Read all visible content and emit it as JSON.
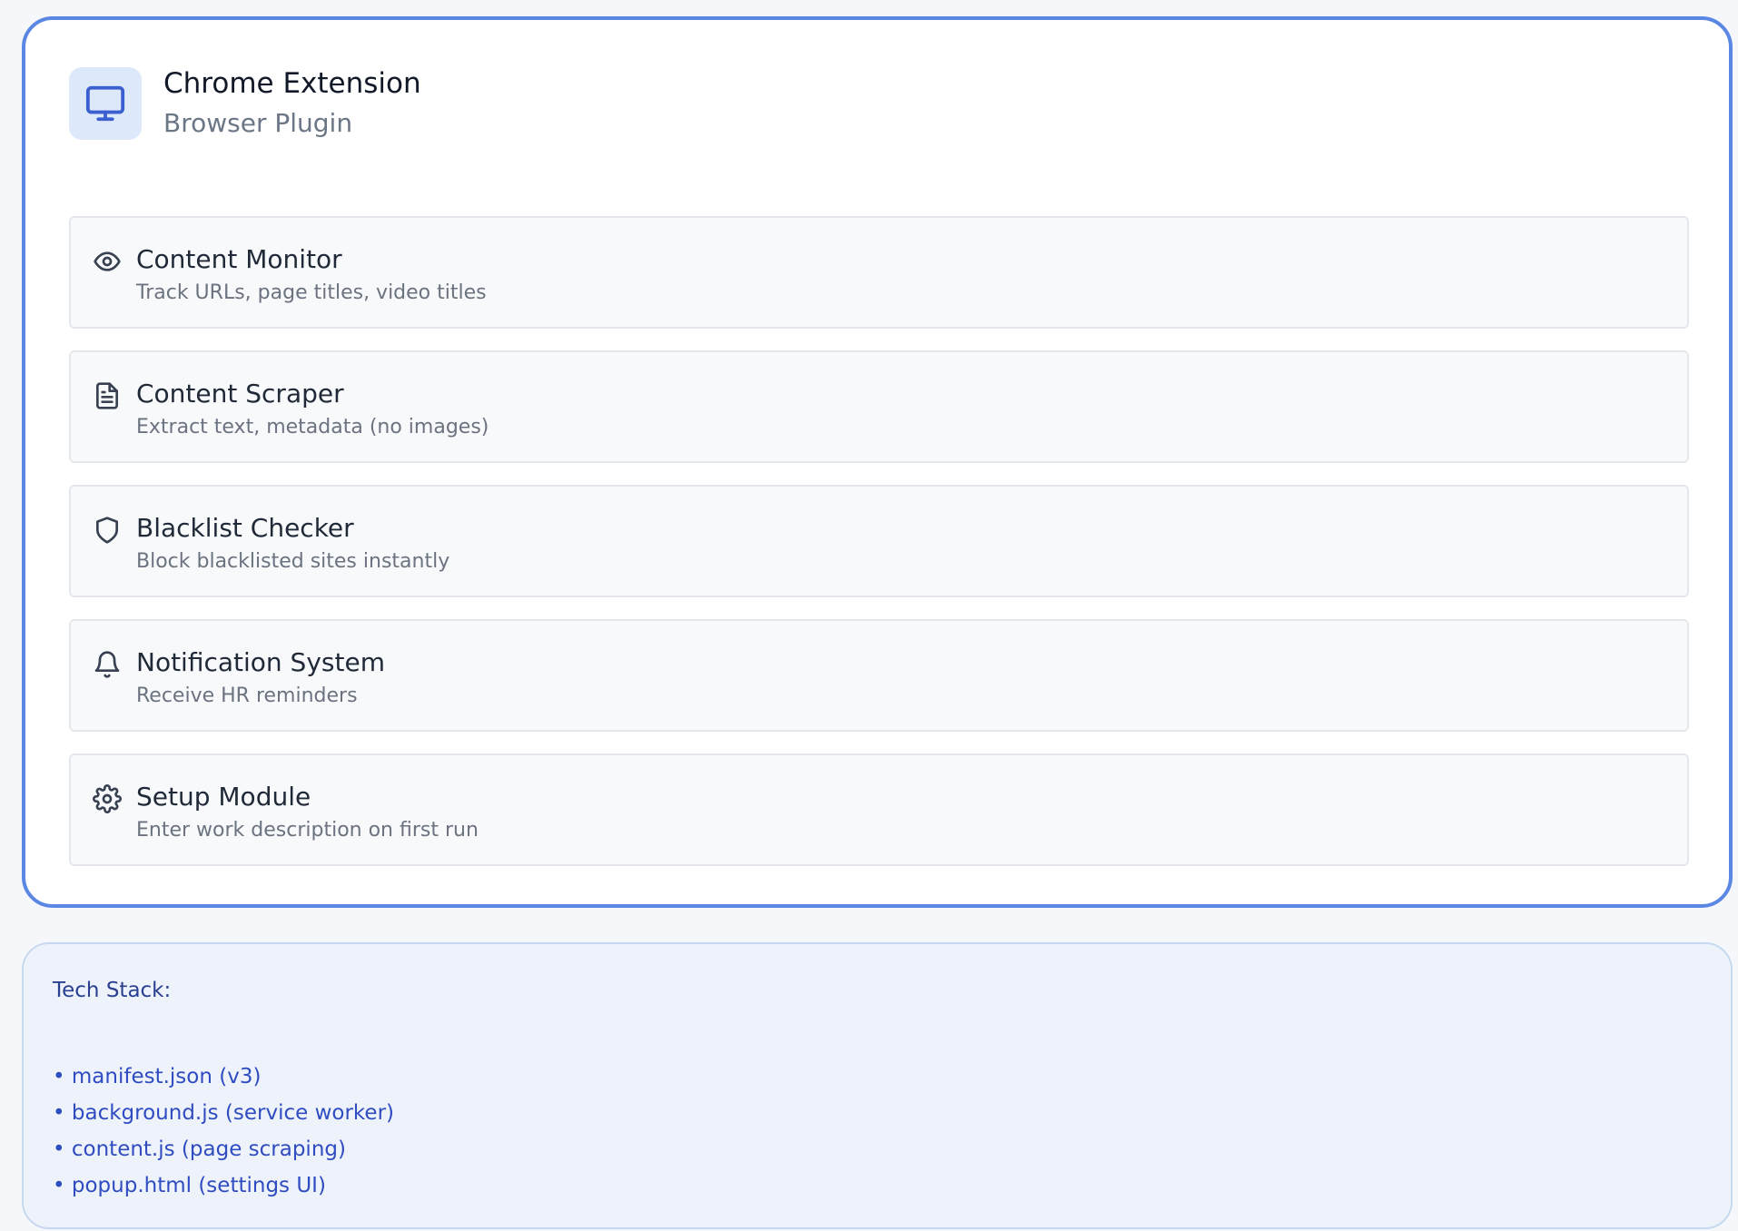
{
  "header": {
    "title": "Chrome Extension",
    "subtitle": "Browser Plugin",
    "icon": "monitor-icon"
  },
  "features": [
    {
      "icon": "eye-icon",
      "title": "Content Monitor",
      "desc": "Track URLs, page titles, video titles"
    },
    {
      "icon": "document-icon",
      "title": "Content Scraper",
      "desc": "Extract text, metadata (no images)"
    },
    {
      "icon": "shield-icon",
      "title": "Blacklist Checker",
      "desc": "Block blacklisted sites instantly"
    },
    {
      "icon": "bell-icon",
      "title": "Notification System",
      "desc": "Receive HR reminders"
    },
    {
      "icon": "gear-icon",
      "title": "Setup Module",
      "desc": "Enter work description on first run"
    }
  ],
  "tech_stack": {
    "title": "Tech Stack:",
    "items": [
      "• manifest.json (v3)",
      "• background.js (service worker)",
      "• content.js (page scraping)",
      "• popup.html (settings UI)"
    ]
  },
  "colors": {
    "accent_border": "#5b87e4",
    "icon_blue": "#3b5fd0",
    "tech_text": "#2f4cc0"
  }
}
